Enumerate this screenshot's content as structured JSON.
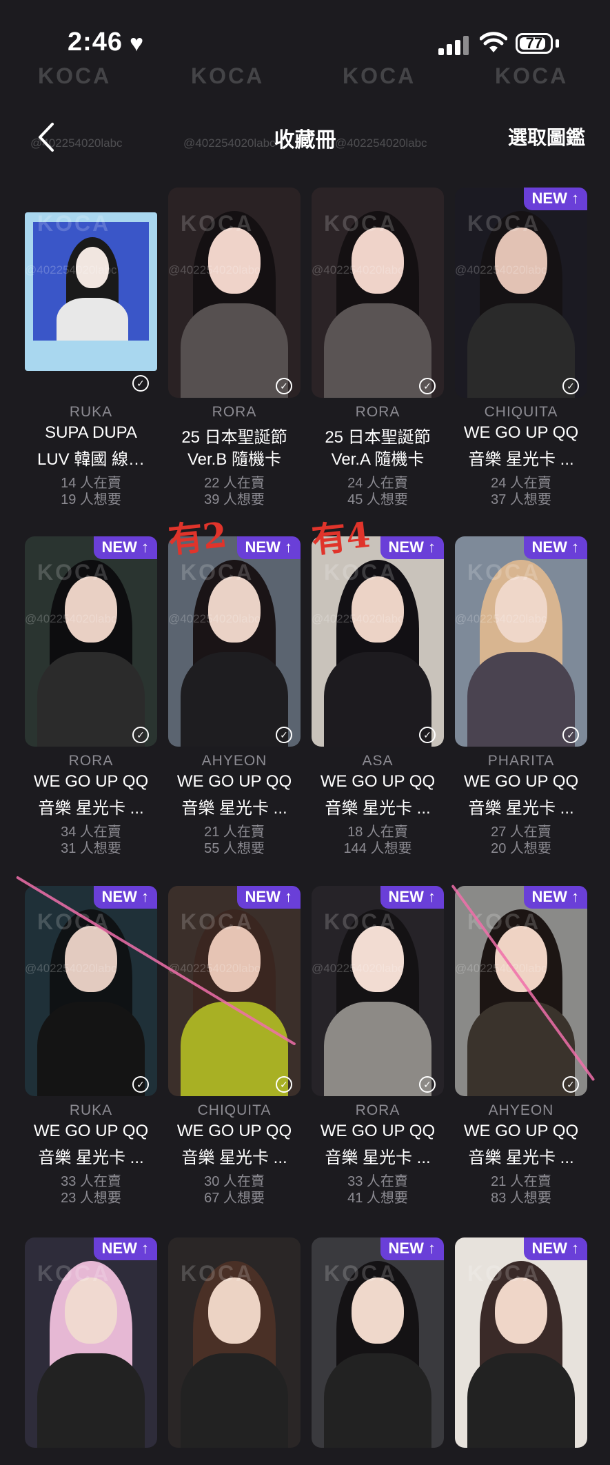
{
  "status": {
    "time": "2:46",
    "battery": "77"
  },
  "watermark": {
    "logo": "KOCA",
    "handle": "@402254020labc"
  },
  "nav": {
    "back_label": "‹",
    "title": "收藏冊",
    "select_label": "選取圖鑑"
  },
  "badge_label": "NEW ↑",
  "annotations": {
    "note1": "有2",
    "note2": "有4"
  },
  "cards": [
    {
      "name": "RUKA",
      "line1": "SUPA DUPA",
      "line2": "LUV 韓國 線…",
      "sell": "14 人在賣",
      "want": "19 人想要",
      "is_new": false
    },
    {
      "name": "RORA",
      "line1": "25 日本聖誕節",
      "line2": "Ver.B 隨機卡",
      "sell": "22 人在賣",
      "want": "39 人想要",
      "is_new": false
    },
    {
      "name": "RORA",
      "line1": "25 日本聖誕節",
      "line2": "Ver.A 隨機卡",
      "sell": "24 人在賣",
      "want": "45 人想要",
      "is_new": false
    },
    {
      "name": "CHIQUITA",
      "line1": "WE GO UP QQ",
      "line2": "音樂 星光卡 ...",
      "sell": "24 人在賣",
      "want": "37 人想要",
      "is_new": true
    },
    {
      "name": "RORA",
      "line1": "WE GO UP QQ",
      "line2": "音樂 星光卡 ...",
      "sell": "34 人在賣",
      "want": "31 人想要",
      "is_new": true
    },
    {
      "name": "AHYEON",
      "line1": "WE GO UP QQ",
      "line2": "音樂 星光卡 ...",
      "sell": "21 人在賣",
      "want": "55 人想要",
      "is_new": true
    },
    {
      "name": "ASA",
      "line1": "WE GO UP QQ",
      "line2": "音樂 星光卡 ...",
      "sell": "18 人在賣",
      "want": "144 人想要",
      "is_new": true
    },
    {
      "name": "PHARITA",
      "line1": "WE GO UP QQ",
      "line2": "音樂 星光卡 ...",
      "sell": "27 人在賣",
      "want": "20 人想要",
      "is_new": true
    },
    {
      "name": "RUKA",
      "line1": "WE GO UP QQ",
      "line2": "音樂 星光卡 ...",
      "sell": "33 人在賣",
      "want": "23 人想要",
      "is_new": true
    },
    {
      "name": "CHIQUITA",
      "line1": "WE GO UP QQ",
      "line2": "音樂 星光卡 ...",
      "sell": "30 人在賣",
      "want": "67 人想要",
      "is_new": true
    },
    {
      "name": "RORA",
      "line1": "WE GO UP QQ",
      "line2": "音樂 星光卡 ...",
      "sell": "33 人在賣",
      "want": "41 人想要",
      "is_new": true
    },
    {
      "name": "AHYEON",
      "line1": "WE GO UP QQ",
      "line2": "音樂 星光卡 ...",
      "sell": "21 人在賣",
      "want": "83 人想要",
      "is_new": true
    },
    {
      "is_new": true
    },
    {
      "is_new": false
    },
    {
      "is_new": true
    },
    {
      "is_new": true
    }
  ],
  "colors": {
    "background": "#1c1b1f",
    "badge": "#6a3fd8",
    "muted_text": "#8c8b92"
  }
}
